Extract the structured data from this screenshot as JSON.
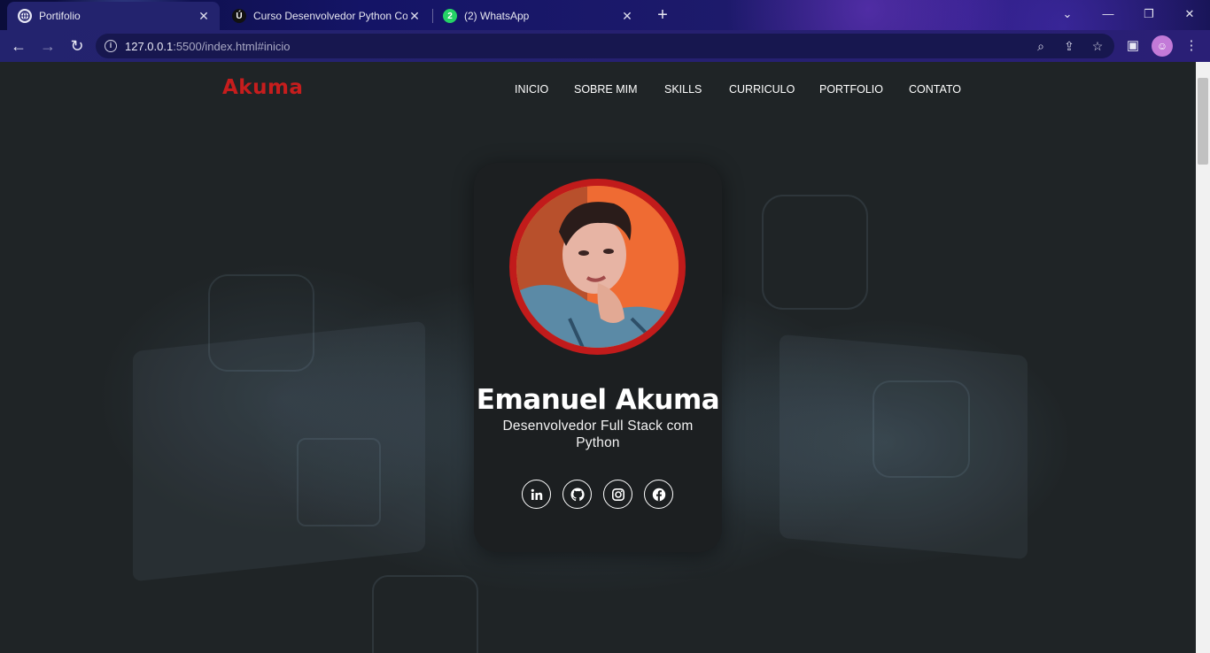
{
  "browser": {
    "tabs": [
      {
        "title": "Portifolio",
        "active": true
      },
      {
        "title": "Curso Desenvolvedor Python Co",
        "favicon_letter": "Ú"
      },
      {
        "title": "(2) WhatsApp",
        "badge": "2"
      }
    ],
    "url_host": "127.0.0.1",
    "url_rest": ":5500/index.html#inicio"
  },
  "page": {
    "brand": "Akuma",
    "nav": [
      "INICIO",
      "SOBRE MIM",
      "SKILLS",
      "CURRICULO",
      "PORTFOLIO",
      "CONTATO"
    ],
    "profile": {
      "name": "Emanuel Akuma",
      "role": "Desenvolvedor Full Stack com Python"
    },
    "socials": [
      "linkedin-icon",
      "github-icon",
      "instagram-icon",
      "facebook-icon"
    ]
  },
  "colors": {
    "accent": "#c61d1d",
    "card_bg": "#1c1f21",
    "page_bg": "#1f2426",
    "tab_bar": "#141466"
  }
}
